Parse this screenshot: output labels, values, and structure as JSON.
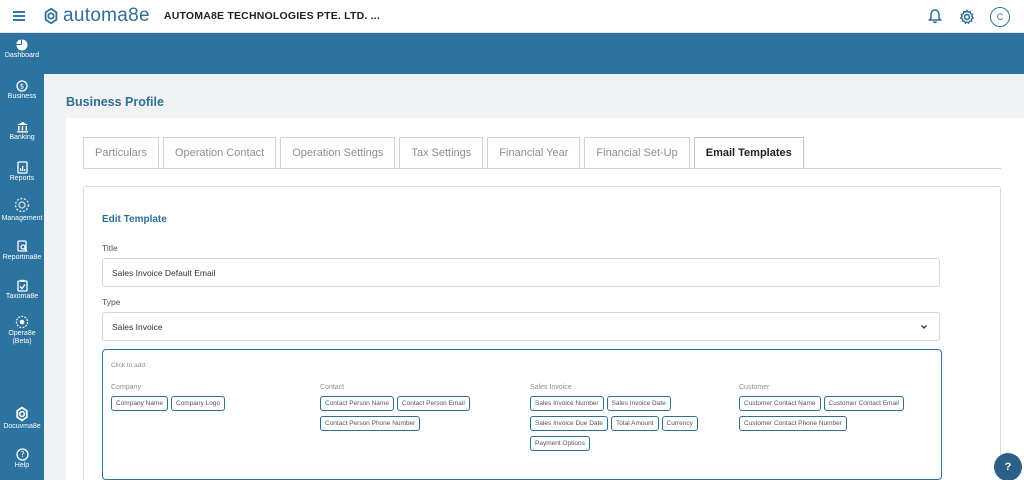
{
  "header": {
    "logo_text": "automa8e",
    "company_name": "AUTOMA8E TECHNOLOGIES PTE. LTD. ...",
    "avatar_initial": "C"
  },
  "sidebar": {
    "items": [
      {
        "label": "Dashboard",
        "icon": "pie-chart-icon"
      },
      {
        "label": "Business",
        "icon": "business-icon"
      },
      {
        "label": "Banking",
        "icon": "bank-icon"
      },
      {
        "label": "Reports",
        "icon": "report-icon"
      },
      {
        "label": "Management",
        "icon": "gear-cluster-icon"
      },
      {
        "label": "Reportma8e",
        "icon": "reportma8e-icon"
      },
      {
        "label": "Taxoma8e",
        "icon": "clipboard-icon"
      },
      {
        "label": "Opera8e\n(Beta)",
        "icon": "opera8e-icon"
      },
      {
        "label": "Docuvma8e",
        "icon": "docuvma8e-icon"
      },
      {
        "label": "Help",
        "icon": "help-icon"
      }
    ]
  },
  "page": {
    "title": "Business Profile"
  },
  "tabs": [
    {
      "label": "Particulars",
      "active": false
    },
    {
      "label": "Operation Contact",
      "active": false
    },
    {
      "label": "Operation Settings",
      "active": false
    },
    {
      "label": "Tax Settings",
      "active": false
    },
    {
      "label": "Financial Year",
      "active": false
    },
    {
      "label": "Financial Set-Up",
      "active": false
    },
    {
      "label": "Email Templates",
      "active": true
    }
  ],
  "form": {
    "section_title": "Edit Template",
    "title_label": "Title",
    "title_value": "Sales Invoice Default Email",
    "type_label": "Type",
    "type_value": "Sales Invoice"
  },
  "tag_box": {
    "hint": "Click to add:",
    "groups": [
      {
        "title": "Company",
        "rows": [
          [
            "Company Name",
            "Company Logo"
          ]
        ]
      },
      {
        "title": "Contact",
        "rows": [
          [
            "Contact Person Name",
            "Contact Person Email"
          ],
          [
            "Contact Person Phone Number"
          ]
        ]
      },
      {
        "title": "Sales Invoice",
        "rows": [
          [
            "Sales Invoice Number",
            "Sales Invoice Date"
          ],
          [
            "Sales Invoice Due Date",
            "Total Amount",
            "Currency"
          ],
          [
            "Payment Options"
          ]
        ]
      },
      {
        "title": "Customer",
        "rows": [
          [
            "Customer Contact Name",
            "Customer Contact Email"
          ],
          [
            "Customer Contact Phone Number"
          ]
        ]
      }
    ]
  },
  "help_bubble": {
    "label": "?"
  },
  "colors": {
    "primary": "#2d73a0",
    "accent_text": "#2d6f96",
    "background": "#f1f2f4"
  }
}
